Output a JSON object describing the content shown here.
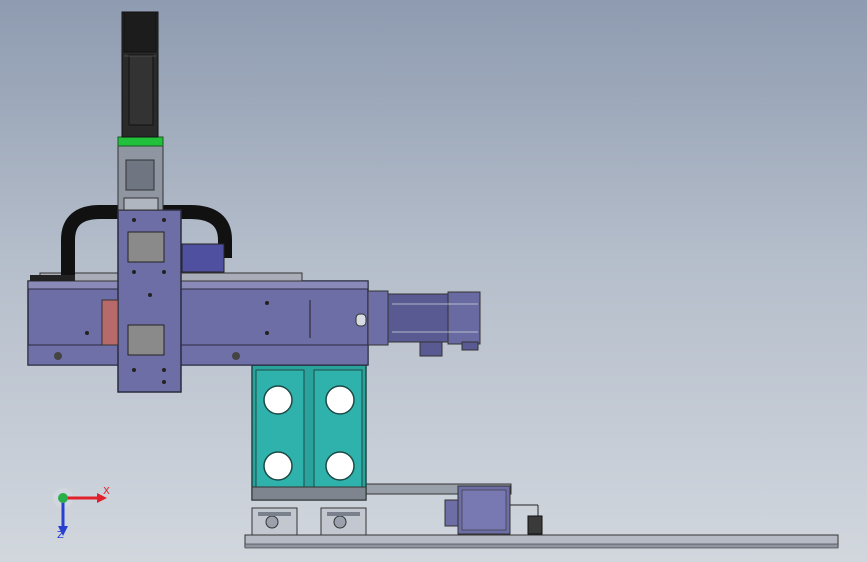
{
  "window": {
    "title": ""
  },
  "colors": {
    "background_top": "#8e9bb0",
    "background_bottom": "#d2d7de",
    "frame_purple": "#6e6ea6",
    "module_teal": "#2aa39d",
    "coupling_green": "#22c13b",
    "motor_gray": "#2a2a2a",
    "base_gray": "#b5bac4",
    "axis_x": "#e0202a",
    "axis_y": "#2ab04a",
    "axis_z": "#2840d0"
  },
  "view_triad": {
    "x_label": "X",
    "z_label": "Z",
    "icon": "coordinate-triad-icon"
  },
  "model": {
    "parts": [
      "vertical-servo-motor",
      "motor-coupling",
      "vertical-axis-carriage",
      "cable-chain",
      "horizontal-axis-beam",
      "horizontal-servo-motor",
      "support-blocks",
      "lower-motor",
      "base-plate"
    ]
  }
}
